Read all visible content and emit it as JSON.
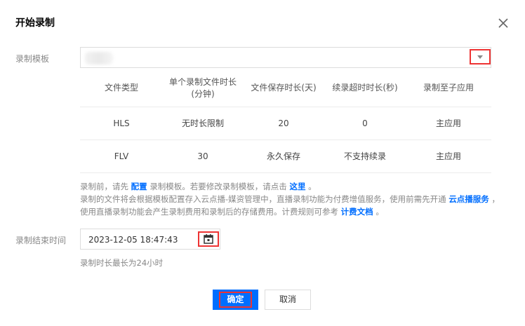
{
  "dialog": {
    "title": "开始录制",
    "close_icon": "close-icon"
  },
  "template": {
    "label": "录制模板",
    "dropdown_icon": "chevron-down-icon",
    "table": {
      "headers": [
        "文件类型",
        "单个录制文件时长\n(分钟)",
        "文件保存时长(天)",
        "续录超时时长(秒)",
        "录制至子应用"
      ],
      "rows": [
        [
          "HLS",
          "无时长限制",
          "20",
          "0",
          "主应用"
        ],
        [
          "FLV",
          "30",
          "永久保存",
          "不支持续录",
          "主应用"
        ]
      ]
    },
    "note1_prefix": "录制前，请先",
    "note1_link1": "配置",
    "note1_mid": "录制模板。若要修改录制模板，请点击",
    "note1_link2": "这里",
    "note1_suffix": "。",
    "note2_prefix": "录制的文件将会根据模板配置存入云点播-媒资管理中，直播录制功能为付费增值服务，使用前需先开通",
    "note2_link1": "云点播服务",
    "note2_mid": "，使用直播录制功能会产生录制费用和录制后的存储费用。计费规则可参考",
    "note2_link2": "计费文档",
    "note2_suffix": "。"
  },
  "end_time": {
    "label": "录制结束时间",
    "value": "2023-12-05 18:47:43",
    "calendar_icon": "calendar-icon",
    "hint": "录制时长最长为24小时"
  },
  "buttons": {
    "ok": "确定",
    "cancel": "取消"
  },
  "colors": {
    "primary": "#006eff",
    "highlight_box": "#ee3333"
  }
}
